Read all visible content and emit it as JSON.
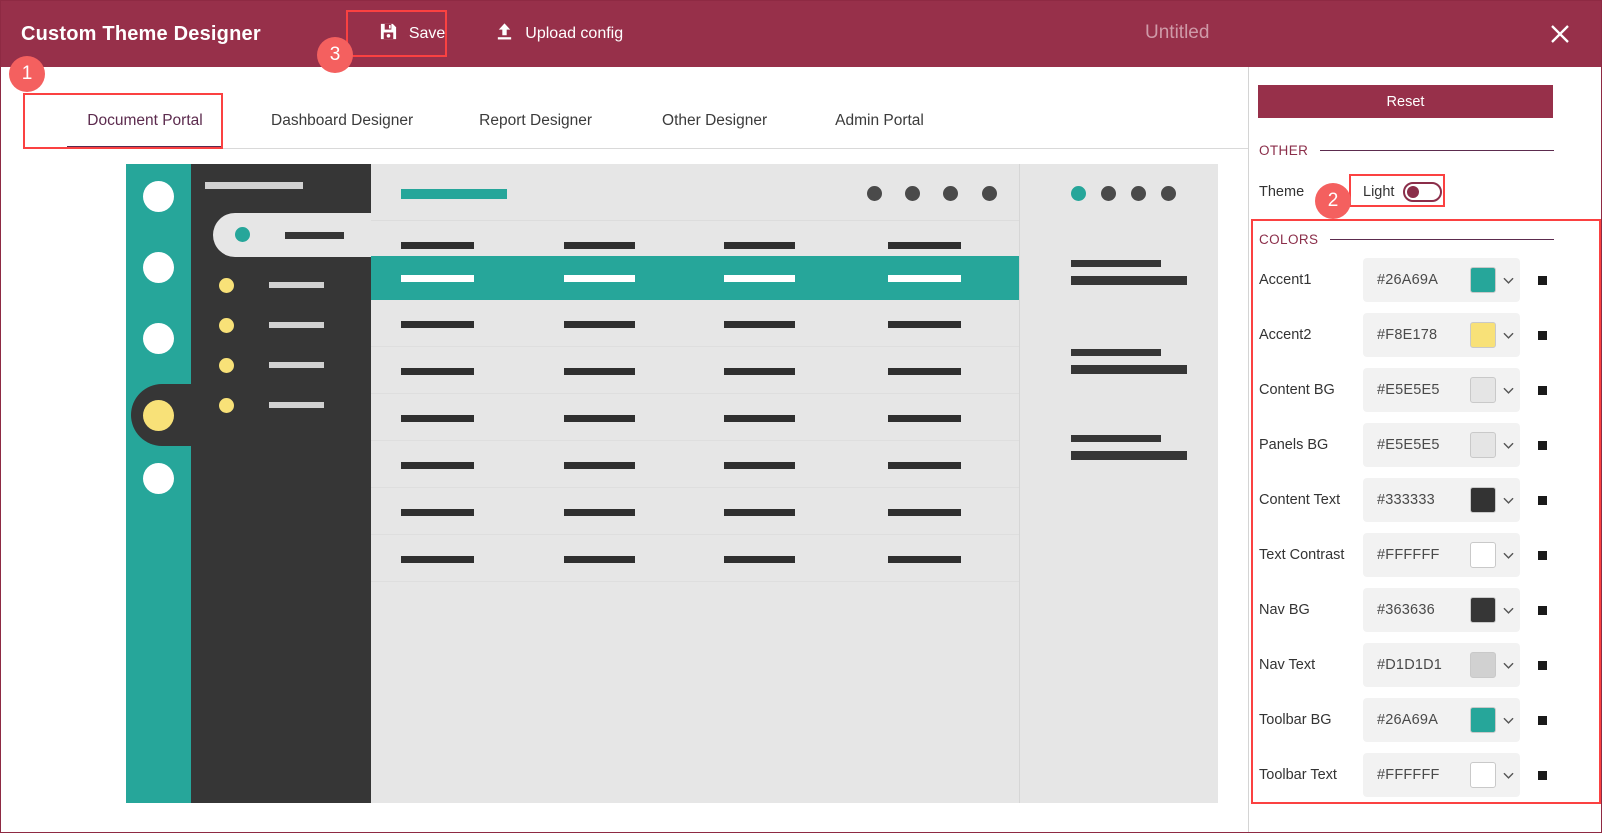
{
  "titlebar": {
    "app_title": "Custom Theme Designer",
    "save_label": "Save",
    "save_icon": "floppy-disk-icon",
    "upload_label": "Upload config",
    "upload_icon": "upload-icon",
    "document_name": "Untitled",
    "close_icon": "close-icon",
    "bg_color": "#97304A"
  },
  "tabs": [
    {
      "label": "Document Portal",
      "active": true
    },
    {
      "label": "Dashboard Designer",
      "active": false
    },
    {
      "label": "Report Designer",
      "active": false
    },
    {
      "label": "Other Designer",
      "active": false
    },
    {
      "label": "Admin Portal",
      "active": false
    }
  ],
  "right_panel": {
    "reset_label": "Reset",
    "other_section": "OTHER",
    "theme_label": "Theme",
    "theme_mode": "Light",
    "colors_section": "COLORS",
    "colors": [
      {
        "label": "Accent1",
        "hex": "#26A69A"
      },
      {
        "label": "Accent2",
        "hex": "#F8E178"
      },
      {
        "label": "Content BG",
        "hex": "#E5E5E5"
      },
      {
        "label": "Panels BG",
        "hex": "#E5E5E5"
      },
      {
        "label": "Content Text",
        "hex": "#333333"
      },
      {
        "label": "Text Contrast",
        "hex": "#FFFFFF"
      },
      {
        "label": "Nav BG",
        "hex": "#363636"
      },
      {
        "label": "Nav Text",
        "hex": "#D1D1D1"
      },
      {
        "label": "Toolbar BG",
        "hex": "#26A69A"
      },
      {
        "label": "Toolbar Text",
        "hex": "#FFFFFF"
      }
    ],
    "chevron_icon": "chevron-down-icon",
    "reset_swatch_icon": "reset-color-square-icon"
  },
  "preview": {
    "accent1": "#26A69A",
    "accent2": "#F8E178",
    "nav_bg": "#363636",
    "content_bg": "#E5E5E5",
    "content_text": "#333333",
    "nav_text": "#D1D1D1"
  },
  "annotations": [
    {
      "number": "1",
      "target": "document-portal-tab"
    },
    {
      "number": "2",
      "target": "theme-toggle"
    },
    {
      "number": "3",
      "target": "save-button"
    }
  ]
}
